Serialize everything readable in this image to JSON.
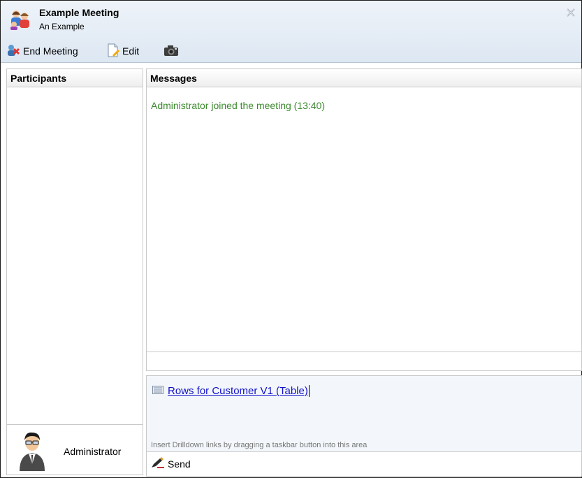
{
  "window": {
    "title": "Example Meeting",
    "subtitle": "An Example",
    "close_icon": "close-icon"
  },
  "toolbar": {
    "end_meeting_label": "End Meeting",
    "edit_label": "Edit",
    "camera_icon": "camera-icon"
  },
  "participants": {
    "header": "Participants",
    "items": [
      {
        "name": "Administrator",
        "icon": "user-avatar-icon"
      }
    ]
  },
  "messages": {
    "header": "Messages",
    "lines": [
      {
        "text": "Administrator joined the meeting (13:40)",
        "color": "#3c8a2e"
      }
    ]
  },
  "compose": {
    "drilldown_link": "Rows for Customer V1 (Table)",
    "hint": "Insert Drilldown links by dragging a taskbar button into this area",
    "send_label": "Send"
  },
  "colors": {
    "header_bg": "#dde7f2",
    "link": "#1010c8",
    "system_message": "#3c8a2e"
  }
}
